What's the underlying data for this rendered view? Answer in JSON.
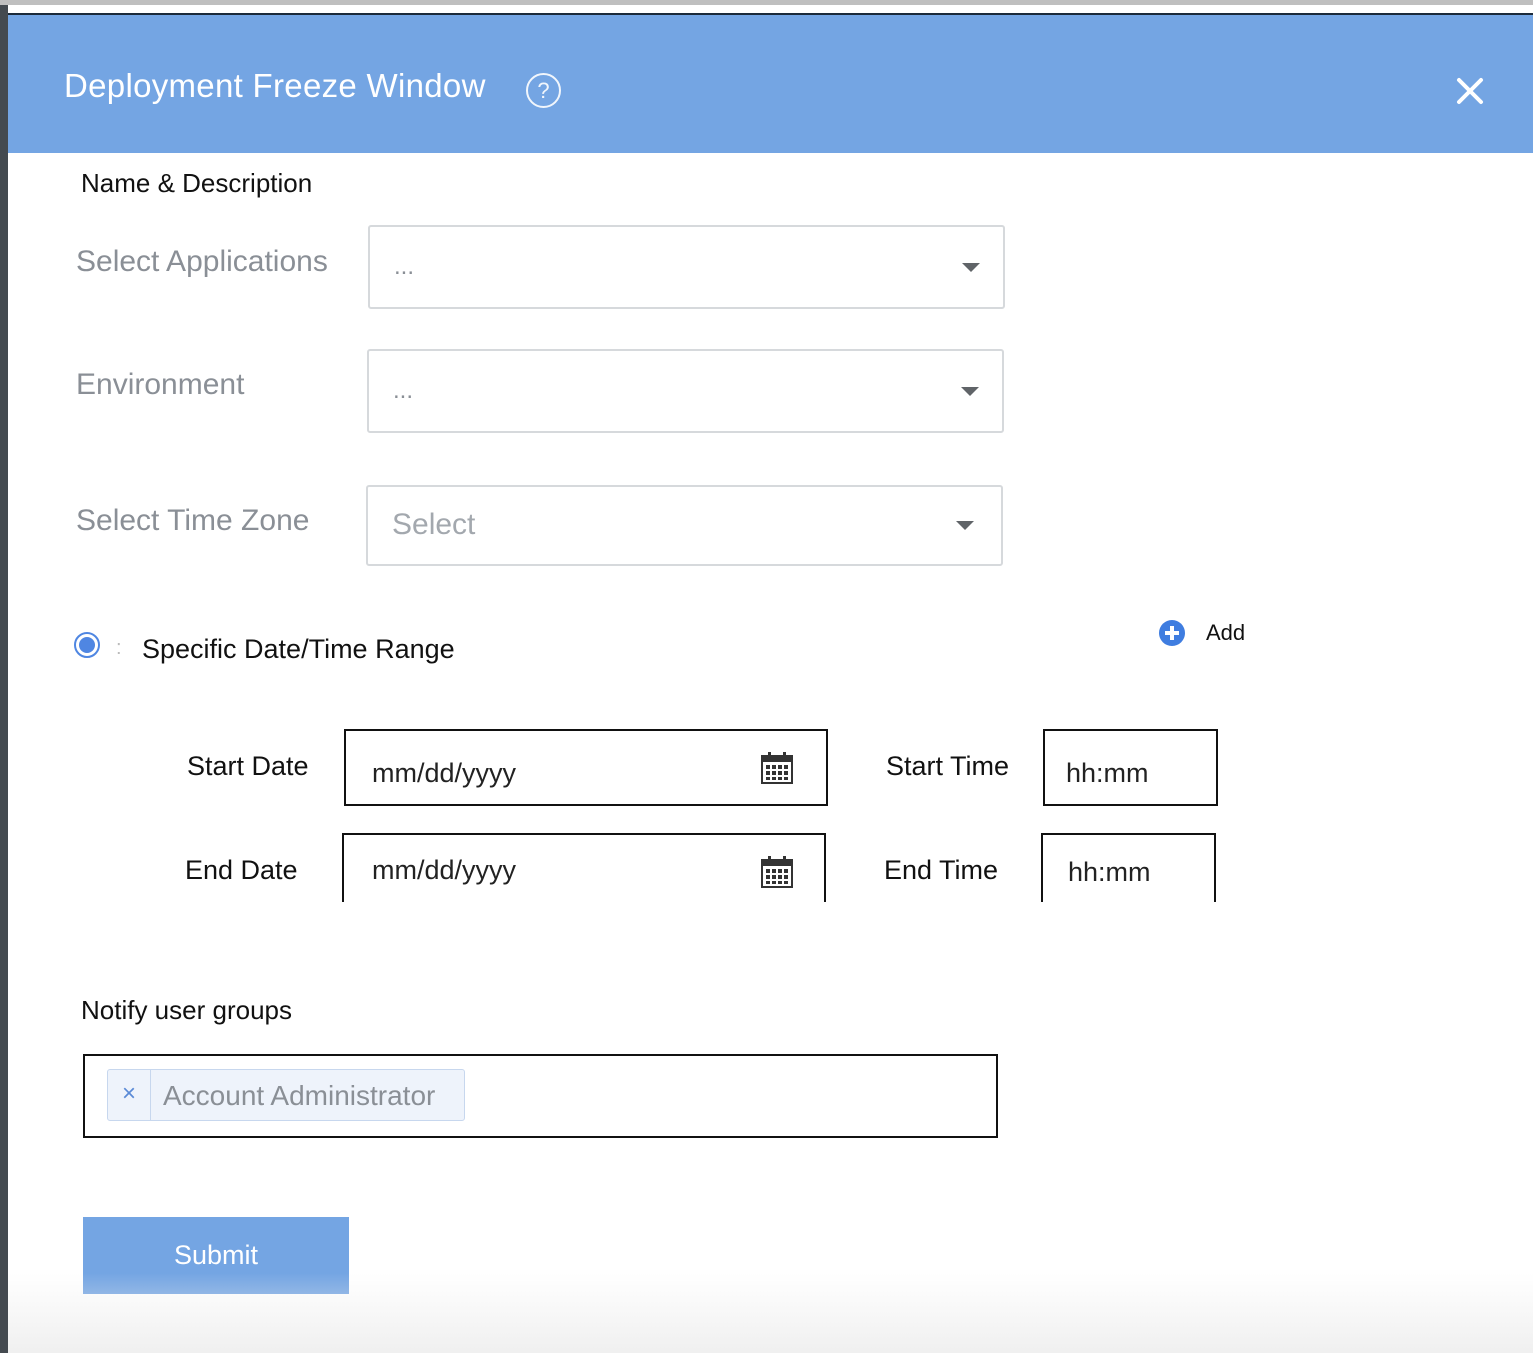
{
  "dialog": {
    "title": "Deployment Freeze Window",
    "help_icon": "question-circle-icon",
    "close_icon": "close-icon",
    "header_color": "#74a5e3"
  },
  "form": {
    "name_description_label": "Name & Description",
    "applications": {
      "label": "Select Applications",
      "value": "..."
    },
    "environment": {
      "label": "Environment",
      "value": "..."
    },
    "time_zone": {
      "label": "Select Time Zone",
      "placeholder": "Select"
    },
    "range_option": {
      "label": "Specific Date/Time Range",
      "selected": true
    },
    "add_label": "Add",
    "start_date": {
      "label": "Start Date",
      "placeholder": "mm/dd/yyyy"
    },
    "start_time": {
      "label": "Start Time",
      "placeholder": "hh:mm"
    },
    "end_date": {
      "label": "End Date",
      "placeholder": "mm/dd/yyyy"
    },
    "end_time": {
      "label": "End Time",
      "placeholder": "hh:mm"
    },
    "notify": {
      "label": "Notify user groups",
      "tags": [
        {
          "remove": "×",
          "label": "Account Administrator"
        }
      ]
    },
    "submit_label": "Submit"
  }
}
